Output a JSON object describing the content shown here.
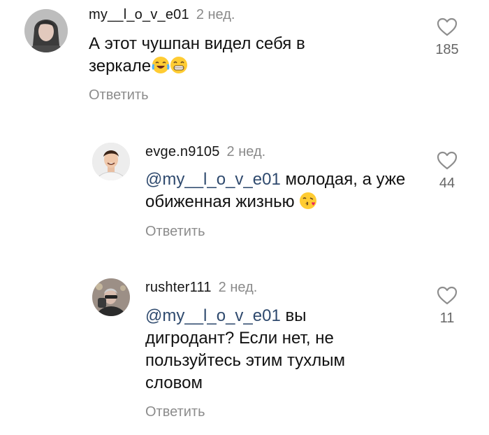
{
  "comments": [
    {
      "username": "my__l_o_v_e01",
      "time": "2 нед.",
      "text": "А этот чушпан видел себя в зеркале",
      "mention": "",
      "emoji": [
        "face-with-tears-of-joy",
        "grinning-face-with-smiling-eyes"
      ],
      "reply_label": "Ответить",
      "likes": "185"
    },
    {
      "username": "evge.n9105",
      "time": "2 нед.",
      "mention": "@my__l_o_v_e01",
      "text": " молодая, а уже обиженная жизнью",
      "emoji": [
        "face-blowing-a-kiss"
      ],
      "reply_label": "Ответить",
      "likes": "44"
    },
    {
      "username": "rushter111",
      "time": "2 нед.",
      "mention": "@my__l_o_v_e01",
      "text": " вы дигродант? Если нет, не пользуйтесь этим тухлым словом",
      "emoji": [],
      "reply_label": "Ответить",
      "likes": "11"
    }
  ],
  "icons": {
    "like": "heart-outline-icon"
  },
  "colors": {
    "mention": "#2f4a6e",
    "secondary_text": "#8c8c8c",
    "primary_text": "#111111"
  }
}
